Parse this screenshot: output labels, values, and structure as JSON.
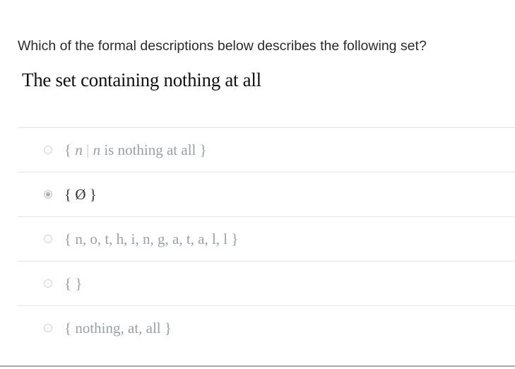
{
  "question": "Which of the formal descriptions below describes the following set?",
  "prompt": "The set containing nothing at all",
  "options": [
    {
      "id": "a",
      "parts": {
        "open": "{",
        "var1": "n",
        "sep": "|",
        "var2": "n",
        "rest": "is nothing at all",
        "close": "}"
      },
      "selected": false
    },
    {
      "id": "b",
      "text": "{ Ø }",
      "selected": true
    },
    {
      "id": "c",
      "text": "{ n, o, t, h, i, n, g, a, t, a, l, l }",
      "selected": false
    },
    {
      "id": "d",
      "text": "{ }",
      "selected": false
    },
    {
      "id": "e",
      "text": "{ nothing, at, all }",
      "selected": false
    }
  ]
}
